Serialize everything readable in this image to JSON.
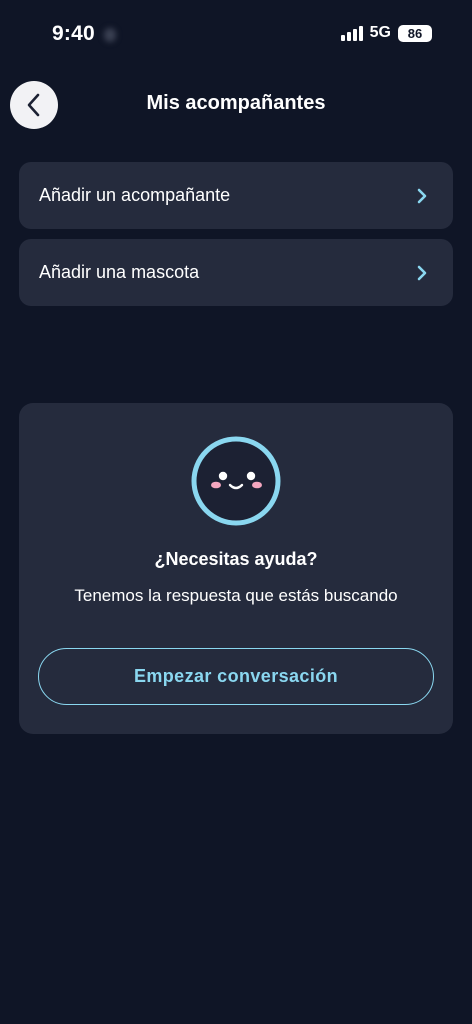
{
  "status_bar": {
    "time": "9:40",
    "network": "5G",
    "battery": "86"
  },
  "header": {
    "title": "Mis acompañantes",
    "back_icon": "chevron-left-icon"
  },
  "list": {
    "items": [
      {
        "label": "Añadir un acompañante",
        "icon": "chevron-right-icon"
      },
      {
        "label": "Añadir una mascota",
        "icon": "chevron-right-icon"
      }
    ]
  },
  "help": {
    "title": "¿Necesitas ayuda?",
    "subtitle": "Tenemos la respuesta que estás buscando",
    "button_label": "Empezar conversación",
    "mascot_icon": "smiley-mascot-icon"
  },
  "colors": {
    "background": "#0f1526",
    "card": "#252b3d",
    "accent": "#8ad7f0"
  }
}
